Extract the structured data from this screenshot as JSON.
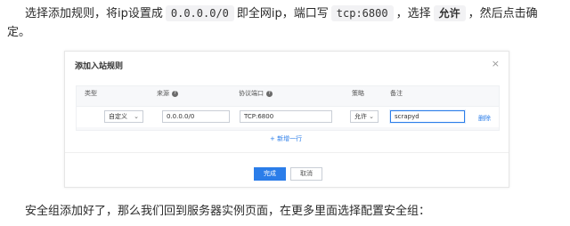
{
  "article": {
    "line1_a": "选择添加规则，将ip设置成",
    "ip_value": "0.0.0.0/0",
    "line1_b": "即全网ip，端口写",
    "port_value": "tcp:6800",
    "line1_c": "，选择",
    "policy_value": "允许",
    "line1_d": "，然后点击确",
    "line2": "定。",
    "line3": "安全组添加好了，那么我们回到服务器实例页面，在更多里面选择配置安全组："
  },
  "dialog": {
    "title": "添加入站规则",
    "close_symbol": "×",
    "columns": {
      "type": "类型",
      "source": "来源",
      "protocol_port": "协议端口",
      "policy": "策略",
      "remark": "备注"
    },
    "help_symbol": "?",
    "row": {
      "type": "自定义",
      "source": "0.0.0.0/0",
      "protocol_port": "TCP:6800",
      "policy": "允许",
      "remark": "scrapyd",
      "delete": "删除"
    },
    "add_row": "+ 新增一行",
    "confirm": "完成",
    "cancel": "取消"
  }
}
